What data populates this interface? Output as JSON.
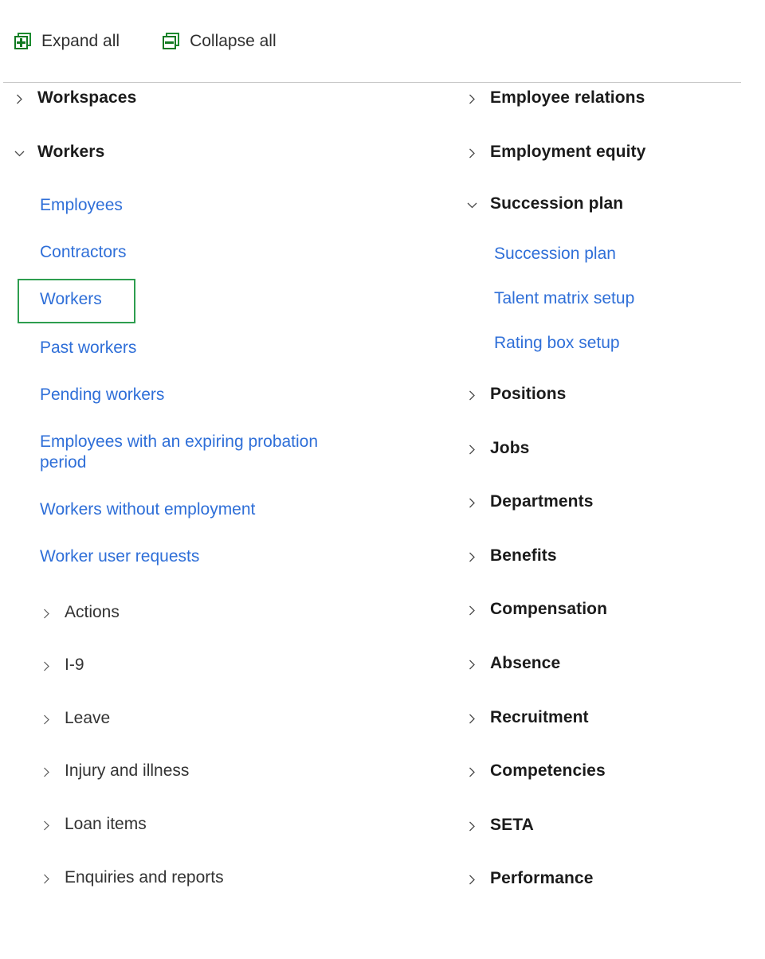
{
  "toolbar": {
    "expand": {
      "label": "Expand all",
      "icon": "expand-all-icon"
    },
    "collapse": {
      "label": "Collapse all",
      "icon": "collapse-all-icon"
    }
  },
  "colors": {
    "link": "#2f6fd8",
    "group_text": "#1b1b1b",
    "toolbar_icon_green": "#127a22",
    "selection_green": "#2e9e4f",
    "annotation_red": "#d22b2b",
    "divider": "#c8c8c8",
    "background": "#ffffff"
  },
  "left_column": {
    "nodes": [
      {
        "type": "group",
        "label": "Workspaces",
        "expanded": false,
        "icon": "chevron-right-icon"
      },
      {
        "type": "group",
        "label": "Workers",
        "expanded": true,
        "icon": "chevron-down-icon"
      },
      {
        "type": "link",
        "label": "Employees"
      },
      {
        "type": "link",
        "label": "Contractors"
      },
      {
        "type": "link",
        "label": "Workers",
        "selected": true
      },
      {
        "type": "link",
        "label": "Past workers"
      },
      {
        "type": "link",
        "label": "Pending workers"
      },
      {
        "type": "link",
        "label": "Employees with an expiring probation period"
      },
      {
        "type": "link",
        "label": "Workers without employment"
      },
      {
        "type": "link",
        "label": "Worker user requests"
      },
      {
        "type": "subgroup",
        "label": "Actions",
        "expanded": false,
        "icon": "chevron-right-icon"
      },
      {
        "type": "subgroup",
        "label": "I-9",
        "expanded": false,
        "icon": "chevron-right-icon"
      },
      {
        "type": "subgroup",
        "label": "Leave",
        "expanded": false,
        "icon": "chevron-right-icon"
      },
      {
        "type": "subgroup",
        "label": "Injury and illness",
        "expanded": false,
        "icon": "chevron-right-icon"
      },
      {
        "type": "subgroup",
        "label": "Loan items",
        "expanded": false,
        "icon": "chevron-right-icon"
      },
      {
        "type": "subgroup",
        "label": "Enquiries and reports",
        "expanded": false,
        "icon": "chevron-right-icon"
      }
    ]
  },
  "right_column": {
    "nodes": [
      {
        "type": "group",
        "label": "Employee relations",
        "expanded": false,
        "icon": "chevron-right-icon"
      },
      {
        "type": "group",
        "label": "Employment equity",
        "expanded": false,
        "icon": "chevron-right-icon"
      },
      {
        "type": "group",
        "label": "Succession plan",
        "expanded": true,
        "icon": "chevron-down-icon",
        "annotated": true
      },
      {
        "type": "link",
        "label": "Succession plan"
      },
      {
        "type": "link",
        "label": "Talent matrix setup"
      },
      {
        "type": "link",
        "label": "Rating box setup"
      },
      {
        "type": "group",
        "label": "Positions",
        "expanded": false,
        "icon": "chevron-right-icon"
      },
      {
        "type": "group",
        "label": "Jobs",
        "expanded": false,
        "icon": "chevron-right-icon"
      },
      {
        "type": "group",
        "label": "Departments",
        "expanded": false,
        "icon": "chevron-right-icon"
      },
      {
        "type": "group",
        "label": "Benefits",
        "expanded": false,
        "icon": "chevron-right-icon"
      },
      {
        "type": "group",
        "label": "Compensation",
        "expanded": false,
        "icon": "chevron-right-icon"
      },
      {
        "type": "group",
        "label": "Absence",
        "expanded": false,
        "icon": "chevron-right-icon"
      },
      {
        "type": "group",
        "label": "Recruitment",
        "expanded": false,
        "icon": "chevron-right-icon"
      },
      {
        "type": "group",
        "label": "Competencies",
        "expanded": false,
        "icon": "chevron-right-icon"
      },
      {
        "type": "group",
        "label": "SETA",
        "expanded": false,
        "icon": "chevron-right-icon"
      },
      {
        "type": "group",
        "label": "Performance",
        "expanded": false,
        "icon": "chevron-right-icon"
      }
    ]
  }
}
